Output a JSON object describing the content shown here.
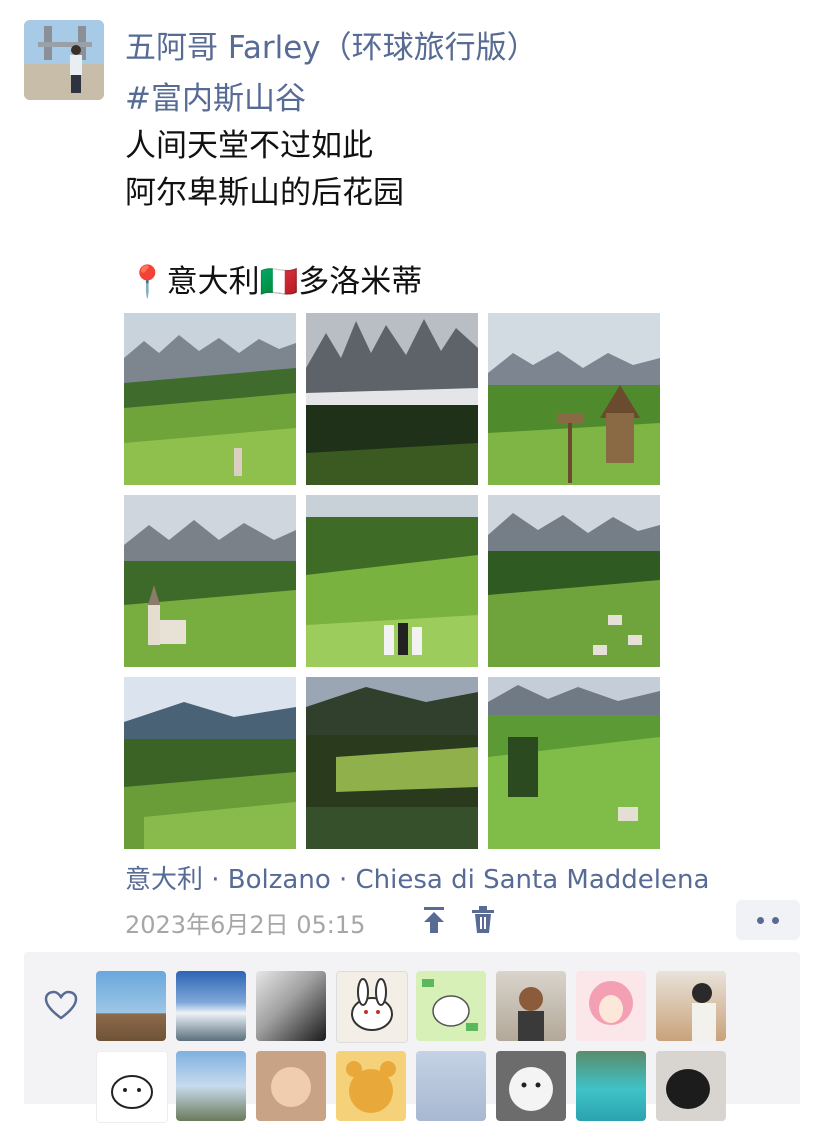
{
  "post": {
    "author": "五阿哥 Farley（环球旅行版）",
    "hashtag": "#富内斯山谷",
    "lines": [
      "人间天堂不过如此",
      "阿尔卑斯山的后花园"
    ],
    "location_line": {
      "pin_icon": "📍",
      "before_flag": "意大利",
      "flag_icon": "🇮🇹",
      "after_flag": "多洛米蒂"
    },
    "photos": [
      {
        "name": "photo-1",
        "scene": "peaks-valley-village"
      },
      {
        "name": "photo-2",
        "scene": "dramatic-peaks-forest"
      },
      {
        "name": "photo-3",
        "scene": "peaks-shrine-signpost"
      },
      {
        "name": "photo-4",
        "scene": "church-meadow"
      },
      {
        "name": "photo-5",
        "scene": "meadow-people"
      },
      {
        "name": "photo-6",
        "scene": "valley-village"
      },
      {
        "name": "photo-7",
        "scene": "wide-valley-clouds"
      },
      {
        "name": "photo-8",
        "scene": "forest-meadow"
      },
      {
        "name": "photo-9",
        "scene": "green-hills-village"
      }
    ],
    "geo_tag": "意大利 · Bolzano · Chiesa di Santa Maddelena",
    "timestamp": "2023年6月2日 05:15"
  },
  "actions": {
    "pin_icon": "pin-top-icon",
    "delete_icon": "trash-icon",
    "more_icon": "more-dots-icon"
  },
  "likes": {
    "heart_icon": "heart-outline-icon",
    "avatars": [
      {
        "name": "like-avatar-1",
        "style": "mountain-pose"
      },
      {
        "name": "like-avatar-2",
        "style": "sky-clouds"
      },
      {
        "name": "like-avatar-3",
        "style": "bw-portrait"
      },
      {
        "name": "like-avatar-4",
        "style": "rabbit-drawing"
      },
      {
        "name": "like-avatar-5",
        "style": "cartoon-green"
      },
      {
        "name": "like-avatar-6",
        "style": "woman-portrait"
      },
      {
        "name": "like-avatar-7",
        "style": "anime-pink-hair"
      },
      {
        "name": "like-avatar-8",
        "style": "man-cafe"
      },
      {
        "name": "like-avatar-9",
        "style": "cartoon-cat"
      },
      {
        "name": "like-avatar-10",
        "style": "person-mountain"
      },
      {
        "name": "like-avatar-11",
        "style": "baby"
      },
      {
        "name": "like-avatar-12",
        "style": "pooh-bear"
      },
      {
        "name": "like-avatar-13",
        "style": "pale-blue"
      },
      {
        "name": "like-avatar-14",
        "style": "white-dog"
      },
      {
        "name": "like-avatar-15",
        "style": "turquoise-lake"
      },
      {
        "name": "like-avatar-16",
        "style": "black-cat"
      }
    ]
  }
}
